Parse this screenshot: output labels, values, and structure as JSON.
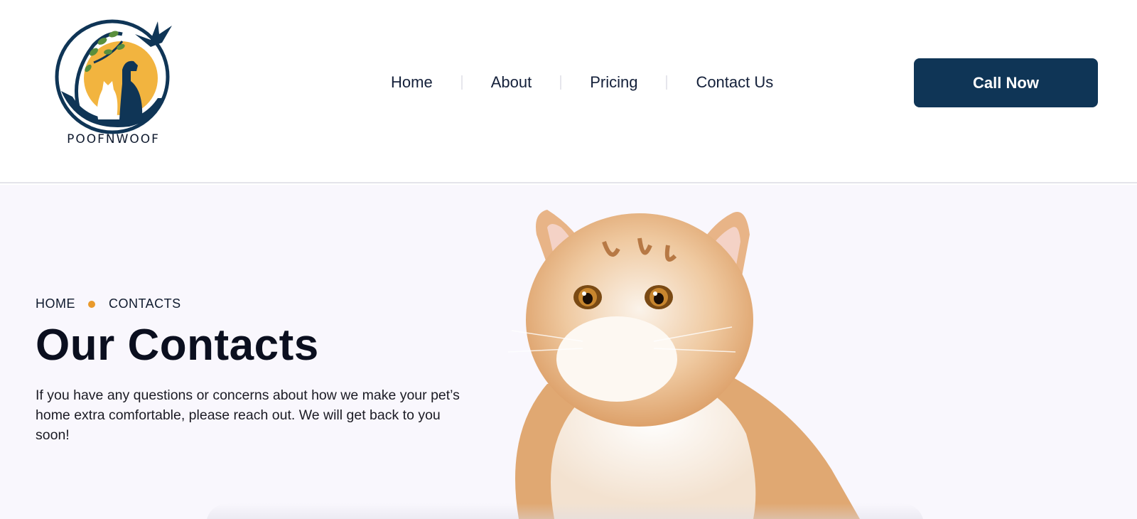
{
  "brand": {
    "name": "POOFNWOOF",
    "colors": {
      "navy": "#0f3556",
      "sun": "#f2b43f",
      "leaf": "#5a8f3c"
    }
  },
  "nav": {
    "items": [
      {
        "label": "Home"
      },
      {
        "label": "About"
      },
      {
        "label": "Pricing"
      },
      {
        "label": "Contact Us"
      }
    ]
  },
  "header": {
    "cta_label": "Call Now"
  },
  "hero": {
    "breadcrumb": {
      "home": "HOME",
      "current": "CONTACTS"
    },
    "title": "Our Contacts",
    "description": "If you have any questions or concerns about how we make your pet’s home extra comfortable, please reach out. We will get back to you soon!",
    "accent": "#e99a2c",
    "image_icon": "cat-photo"
  }
}
